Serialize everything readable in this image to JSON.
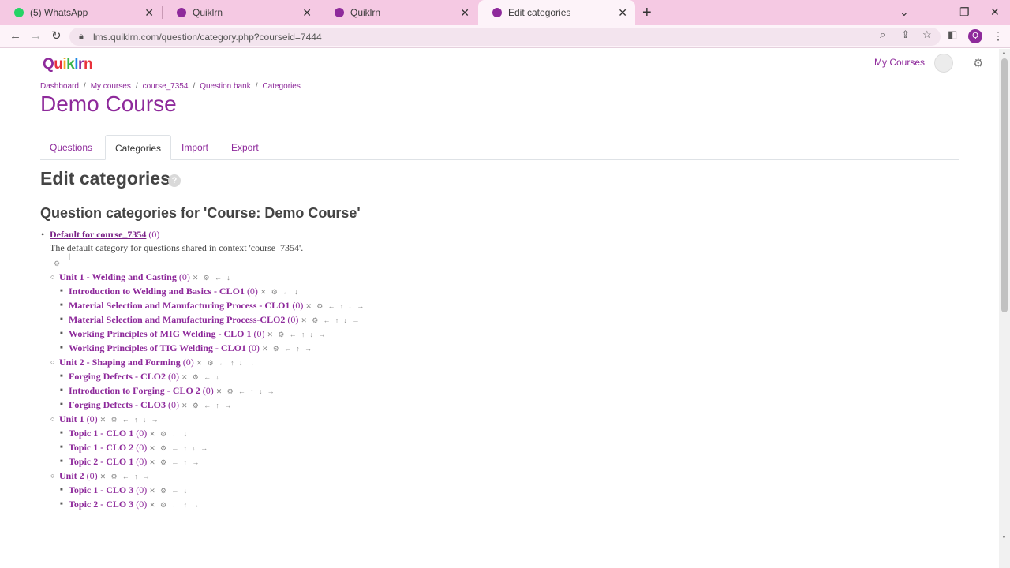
{
  "browser": {
    "tabs": [
      {
        "title": "(5) WhatsApp",
        "active": false,
        "color": "#25d366"
      },
      {
        "title": "Quiklrn",
        "active": false,
        "color": "#8e2a9b"
      },
      {
        "title": "Quiklrn",
        "active": false,
        "color": "#8e2a9b"
      },
      {
        "title": "Edit categories",
        "active": true,
        "color": "#8e2a9b"
      }
    ],
    "url": "lms.quiklrn.com/question/category.php?courseid=7444",
    "profile_initial": "Q"
  },
  "header": {
    "logo_letters": [
      "Q",
      "u",
      "i",
      "k",
      "l",
      "r",
      "n"
    ],
    "my_courses": "My Courses"
  },
  "breadcrumb": [
    "Dashboard",
    "My courses",
    "course_7354",
    "Question bank",
    "Categories"
  ],
  "page_title": "Demo Course",
  "tabs": [
    "Questions",
    "Categories",
    "Import",
    "Export"
  ],
  "active_tab": "Categories",
  "section_title": "Edit categories",
  "help_icon": "?",
  "subsection_title": "Question categories for 'Course: Demo Course'",
  "top_category": {
    "name": "Default for course_7354",
    "count": "(0)"
  },
  "description": "The default category for questions shared in context 'course_7354'.",
  "categories": [
    {
      "name": "Unit 1 - Welding and Casting",
      "count": "(0)",
      "actions": "✕ ⚙ ← ↓",
      "level": 1
    },
    {
      "name": "Introduction to Welding and Basics - CLO1",
      "count": "(0)",
      "actions": "✕ ⚙ ← ↓",
      "level": 2
    },
    {
      "name": "Material Selection and Manufacturing Process - CLO1",
      "count": "(0)",
      "actions": "✕ ⚙ ← ↑ ↓ →",
      "level": 2
    },
    {
      "name": "Material Selection and Manufacturing Process-CLO2",
      "count": "(0)",
      "actions": "✕ ⚙ ← ↑ ↓ →",
      "level": 2
    },
    {
      "name": "Working Principles of MIG Welding - CLO 1",
      "count": "(0)",
      "actions": "✕ ⚙ ← ↑ ↓ →",
      "level": 2
    },
    {
      "name": "Working Principles of TIG Welding - CLO1",
      "count": "(0)",
      "actions": "✕ ⚙ ← ↑ →",
      "level": 2
    },
    {
      "name": "Unit 2 - Shaping and Forming",
      "count": "(0)",
      "actions": "✕ ⚙ ← ↑ ↓ →",
      "level": 1
    },
    {
      "name": "Forging Defects - CLO2",
      "count": "(0)",
      "actions": "✕ ⚙ ← ↓",
      "level": 2
    },
    {
      "name": "Introduction to Forging - CLO 2",
      "count": "(0)",
      "actions": "✕ ⚙ ← ↑ ↓ →",
      "level": 2
    },
    {
      "name": "Forging Defects - CLO3",
      "count": "(0)",
      "actions": "✕ ⚙ ← ↑ →",
      "level": 2
    },
    {
      "name": "Unit 1",
      "count": "(0)",
      "actions": "✕ ⚙ ← ↑ ↓ →",
      "level": 1
    },
    {
      "name": "Topic 1 - CLO 1",
      "count": "(0)",
      "actions": "✕ ⚙ ← ↓",
      "level": 2
    },
    {
      "name": "Topic 1 - CLO 2",
      "count": "(0)",
      "actions": "✕ ⚙ ← ↑ ↓ →",
      "level": 2
    },
    {
      "name": "Topic 2 - CLO 1",
      "count": "(0)",
      "actions": "✕ ⚙ ← ↑ →",
      "level": 2
    },
    {
      "name": "Unit 2",
      "count": "(0)",
      "actions": "✕ ⚙ ← ↑ →",
      "level": 1
    },
    {
      "name": "Topic 1 - CLO 3",
      "count": "(0)",
      "actions": "✕ ⚙ ← ↓",
      "level": 2
    },
    {
      "name": "Topic 2 - CLO 3",
      "count": "(0)",
      "actions": "✕ ⚙ ← ↑ →",
      "level": 2
    }
  ]
}
